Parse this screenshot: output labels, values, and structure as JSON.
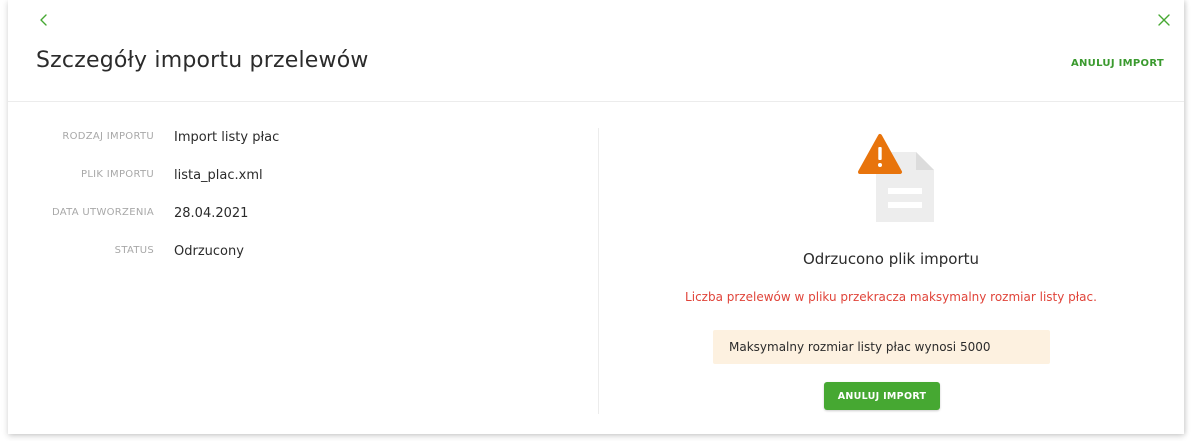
{
  "header": {
    "title": "Szczegóły importu przelewów",
    "cancel_link": "ANULUJ IMPORT",
    "back_icon": "chevron-left-icon",
    "close_icon": "close-icon"
  },
  "details": [
    {
      "label": "RODZAJ IMPORTU",
      "value": "Import listy płac"
    },
    {
      "label": "PLIK IMPORTU",
      "value": "lista_plac.xml"
    },
    {
      "label": "DATA UTWORZENIA",
      "value": "28.04.2021"
    },
    {
      "label": "STATUS",
      "value": "Odrzucony"
    }
  ],
  "result": {
    "icon": "file-warning-icon",
    "title": "Odrzucono plik importu",
    "error": "Liczba przelewów w pliku przekracza maksymalny rozmiar listy płac.",
    "info": "Maksymalny rozmiar listy płac wynosi 5000",
    "button": "ANULUJ IMPORT"
  },
  "colors": {
    "accent": "#46a832",
    "error": "#e0443a",
    "warning": "#e8740c",
    "info_bg": "#fdf1e0"
  }
}
